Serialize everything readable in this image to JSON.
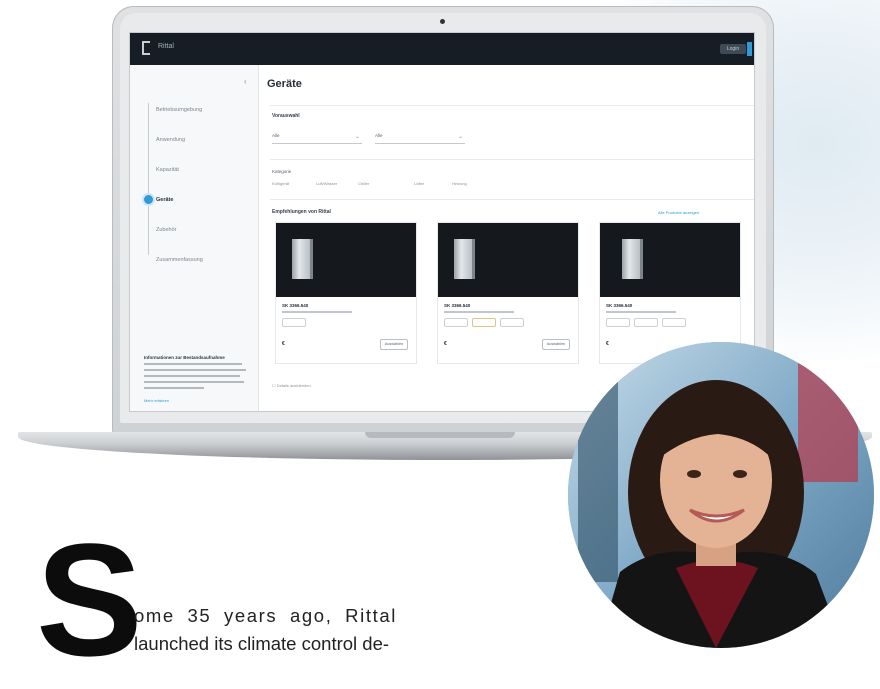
{
  "screen": {
    "app_label": "Rittal",
    "account_label": "Login",
    "page_title": "Geräte",
    "sidebar_steps": [
      "Betriebsumgebung",
      "Anwendung",
      "Kapazität",
      "Geräte",
      "Zubehör",
      "Zusammenfassung"
    ],
    "active_step_index": 3,
    "info_title": "Informationen zur Bestandsaufnahme",
    "info_link": "Mehr erfahren",
    "section_filter_title": "Vorauswahl",
    "select_1": "Alle",
    "select_2": "Alle",
    "filter_label": "Kategorie",
    "filter_chips": [
      "Kühlgerät",
      "Luft/Wasser",
      "Chiller",
      "Lüfter",
      "Heizung"
    ],
    "section_products_title": "Empfehlungen von Rittal",
    "products_link": "Alle Produkte anzeigen",
    "products": [
      {
        "name": "SK 3366.540",
        "price": "€"
      },
      {
        "name": "SK 3366.540",
        "price": "€"
      },
      {
        "name": "SK 3366.540",
        "price": "€"
      }
    ],
    "product_button": "Auswählen",
    "footer_check": "Details ausblenden"
  },
  "colors": {
    "accent": "#2e9ad6",
    "topbar": "#161d24"
  },
  "article": {
    "dropcap": "S",
    "lead_lines": [
      "ome 35 years ago, Rittal",
      "launched its climate control de-"
    ]
  }
}
